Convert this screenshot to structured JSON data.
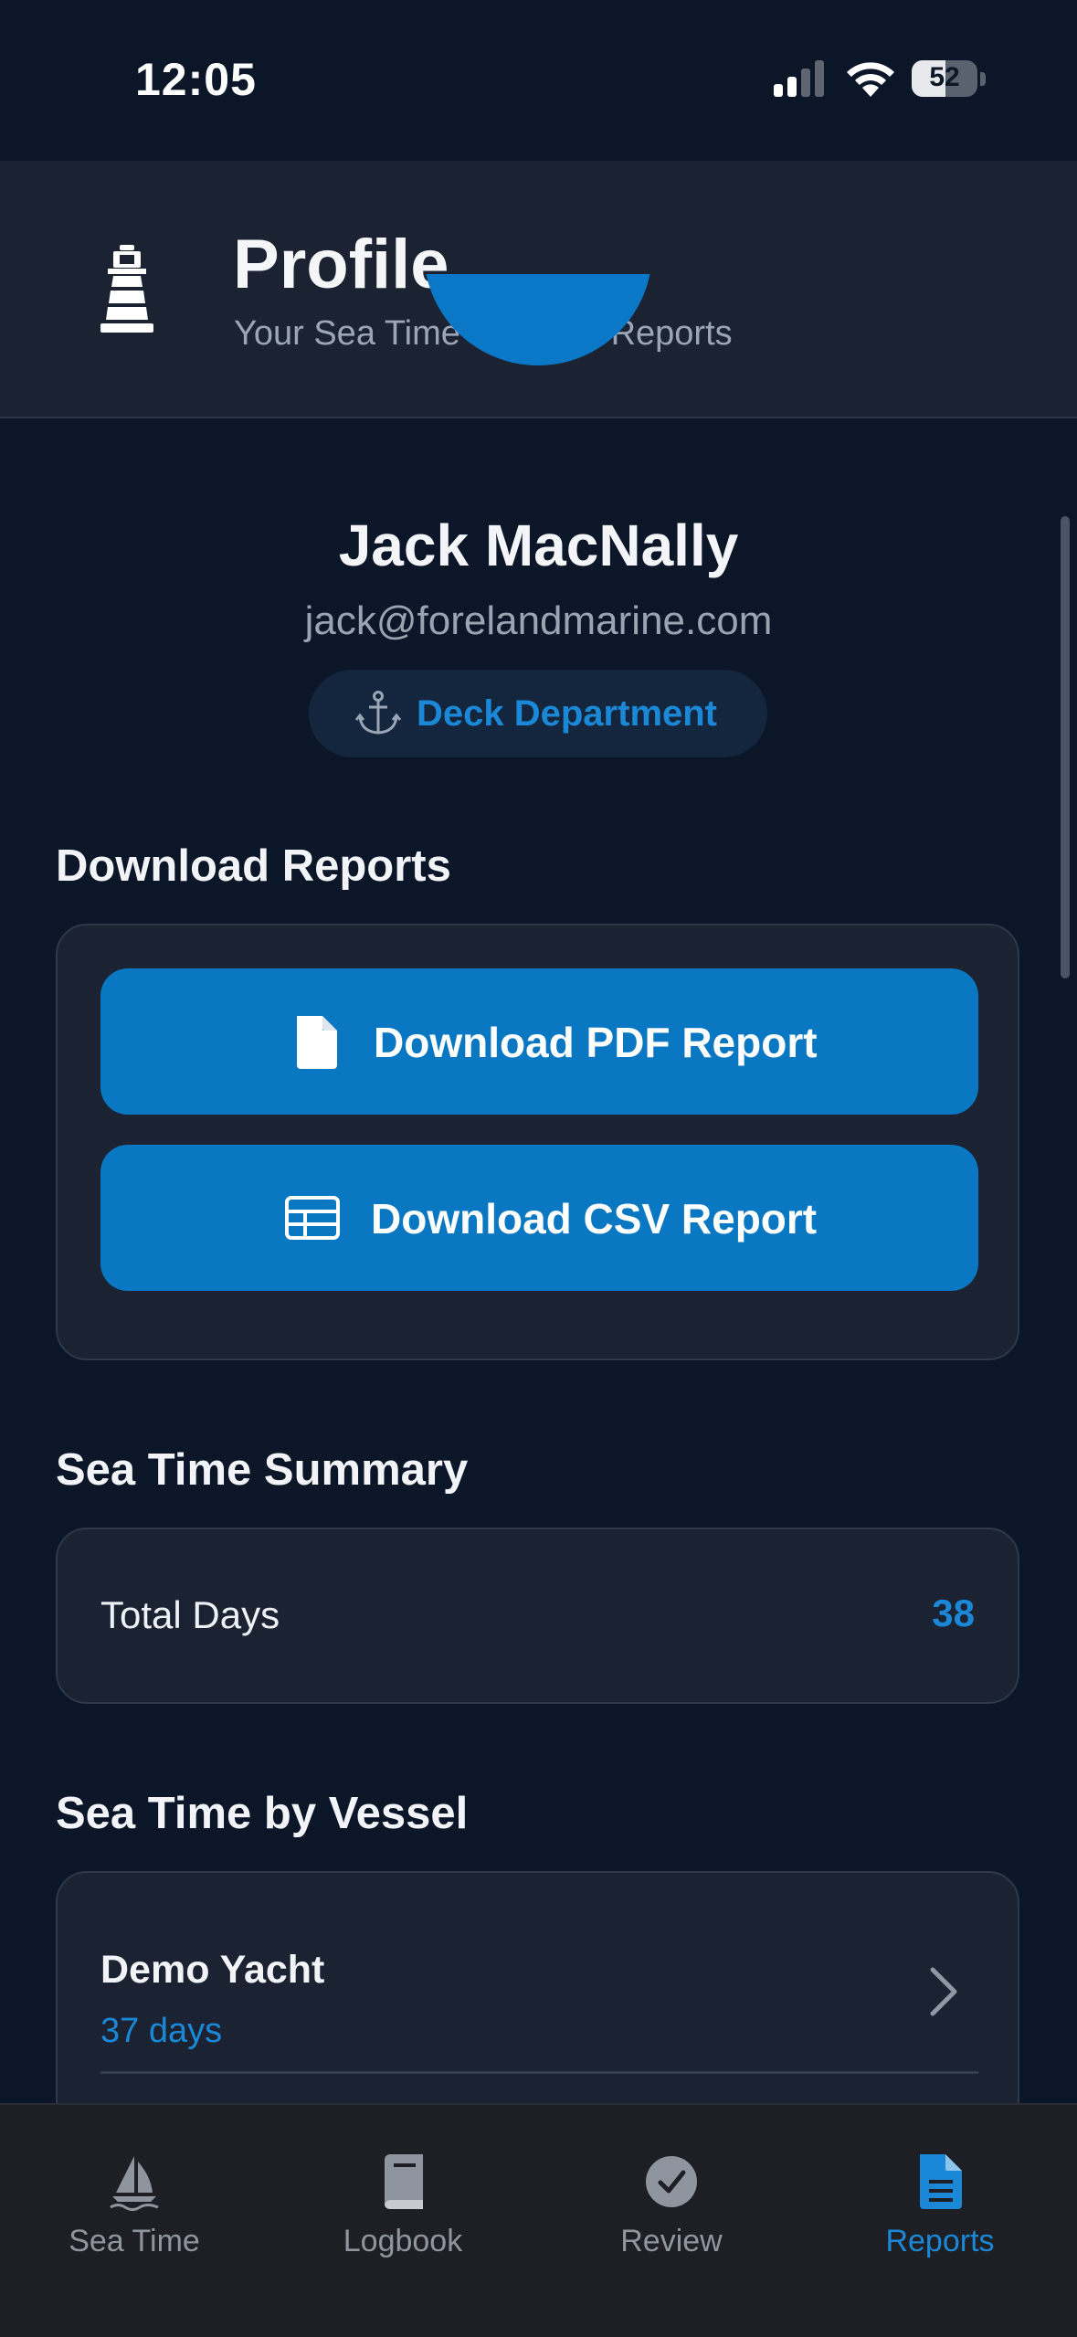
{
  "status_bar": {
    "time": "12:05",
    "battery_percent": "52",
    "battery_level": 0.52
  },
  "header": {
    "title": "Profile",
    "subtitle": "Your Sea Time Profile & Reports",
    "logo_icon": "lighthouse-icon"
  },
  "profile": {
    "name": "Jack MacNally",
    "email": "jack@forelandmarine.com",
    "department": "Deck Department",
    "department_icon": "anchor-icon"
  },
  "download_reports": {
    "title": "Download Reports",
    "pdf_label": "Download PDF Report",
    "pdf_icon": "document-icon",
    "csv_label": "Download CSV Report",
    "csv_icon": "table-icon"
  },
  "summary": {
    "title": "Sea Time Summary",
    "total_days_label": "Total Days",
    "total_days_value": "38"
  },
  "by_vessel": {
    "title": "Sea Time by Vessel",
    "vessels": [
      {
        "name": "Demo Yacht",
        "days": "37 days"
      }
    ]
  },
  "tabs": [
    {
      "label": "Sea Time",
      "icon": "sailboat-icon",
      "active": false
    },
    {
      "label": "Logbook",
      "icon": "book-icon",
      "active": false
    },
    {
      "label": "Review",
      "icon": "checkmark-circle-icon",
      "active": false
    },
    {
      "label": "Reports",
      "icon": "document-icon",
      "active": true
    }
  ],
  "colors": {
    "accent": "#0a77c2",
    "accent_text": "#1a88d6",
    "background": "#0b1729",
    "card": "#1b2333",
    "tabbar": "#1d1f24"
  }
}
